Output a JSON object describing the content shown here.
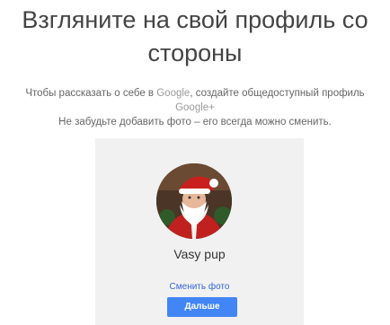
{
  "header": {
    "title": "Взгляните на свой профиль со стороны"
  },
  "description": {
    "line1_before": "Чтобы рассказать о себе в ",
    "line1_google": "Google",
    "line1_after": ", создайте общедоступный профиль",
    "line2_google_plus": "Google+",
    "line3": "Не забудьте добавить фото – его всегда можно сменить."
  },
  "profile": {
    "avatar_icon": "santa-claus-photo",
    "name": "Vasy pup",
    "change_photo_label": "Сменить фото",
    "next_button_label": "Дальше"
  },
  "colors": {
    "link": "#3367d6",
    "button": "#4285f4",
    "card_bg": "#f1f1f1"
  }
}
